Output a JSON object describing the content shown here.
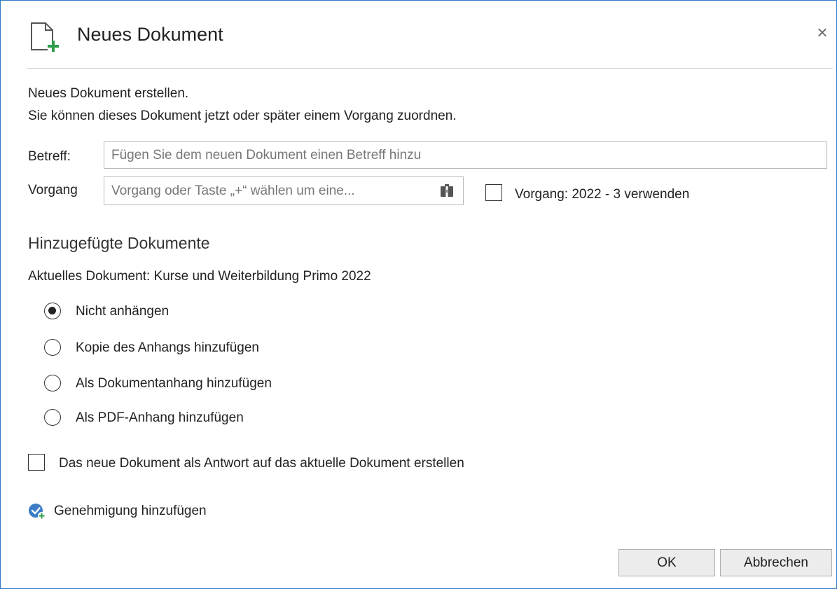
{
  "dialog": {
    "title": "Neues Dokument",
    "close_label": "×",
    "intro_line1": "Neues Dokument erstellen.",
    "intro_line2": "Sie können dieses Dokument jetzt oder später einem Vorgang zuordnen."
  },
  "form": {
    "subject_label": "Betreff:",
    "subject_value": "",
    "subject_placeholder": "Fügen Sie dem neuen Dokument einen Betreff hinzu",
    "vorgang_label": "Vorgang",
    "vorgang_value": "",
    "vorgang_placeholder": "Vorgang oder Taste „+“ wählen um eine...",
    "use_vorgang_checked": false,
    "use_vorgang_label": "Vorgang: 2022 - 3 verwenden"
  },
  "attachments": {
    "heading": "Hinzugefügte Dokumente",
    "current_document": "Aktuelles Dokument: Kurse und Weiterbildung Primo 2022",
    "selected_option": "Nicht anhängen",
    "options": [
      {
        "label": "Nicht anhängen",
        "checked": true
      },
      {
        "label": "Kopie des Anhangs hinzufügen",
        "checked": false
      },
      {
        "label": "Als Dokumentanhang hinzufügen",
        "checked": false
      },
      {
        "label": "Als PDF-Anhang hinzufügen",
        "checked": false
      }
    ]
  },
  "reply": {
    "checked": false,
    "label": "Das neue Dokument als Antwort auf das aktuelle Dokument erstellen"
  },
  "approval": {
    "label": "Genehmigung hinzufügen",
    "icon": "approval-add-icon"
  },
  "buttons": {
    "ok": "OK",
    "cancel": "Abbrechen"
  },
  "colors": {
    "accent": "#2b78c5",
    "doc_icon_plus": "#2e9e4a",
    "approval_icon": "#3b7dc6"
  }
}
